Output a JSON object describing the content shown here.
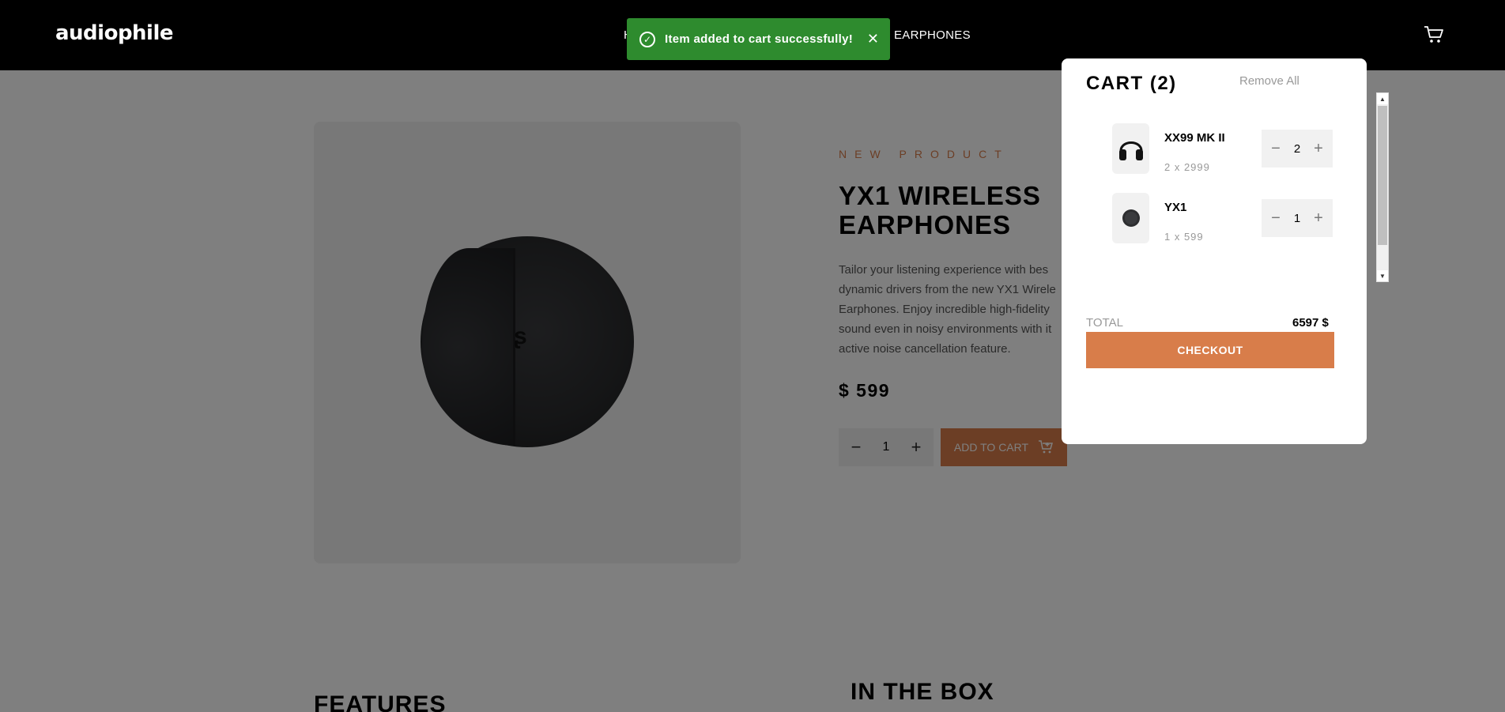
{
  "header": {
    "logo": "audiophile",
    "nav": {
      "home_partial": "H",
      "earphones": "EARPHONES"
    },
    "cart_icon": "cart-icon"
  },
  "product": {
    "overline": "NEW PRODUCT",
    "title": "YX1 WIRELESS EARPHONES",
    "description": "Tailor your listening experience with bes dynamic drivers from the new YX1 Wirele Earphones. Enjoy incredible high-fidelity sound even in noisy environments with it active noise cancellation feature.",
    "price": "$ 599",
    "quantity": "1",
    "add_to_cart_label": "ADD TO CART"
  },
  "sections": {
    "features": "FEATURES",
    "in_the_box": "IN THE BOX"
  },
  "toast": {
    "message": "Item added to cart successfully!",
    "icon": "check-circle-icon"
  },
  "cart": {
    "title": "CART (2)",
    "remove_all": "Remove All",
    "items": [
      {
        "name": "XX99 MK II",
        "subtitle": "2 x 2999",
        "quantity": "2",
        "icon": "headphones-icon"
      },
      {
        "name": "YX1",
        "subtitle": "1 x 599",
        "quantity": "1",
        "icon": "earphone-icon"
      }
    ],
    "total_label": "TOTAL",
    "total_value": "6597 $",
    "checkout_label": "CHECKOUT"
  },
  "colors": {
    "accent": "#d87d4a",
    "toast": "#2e8b2e",
    "header": "#000000"
  }
}
